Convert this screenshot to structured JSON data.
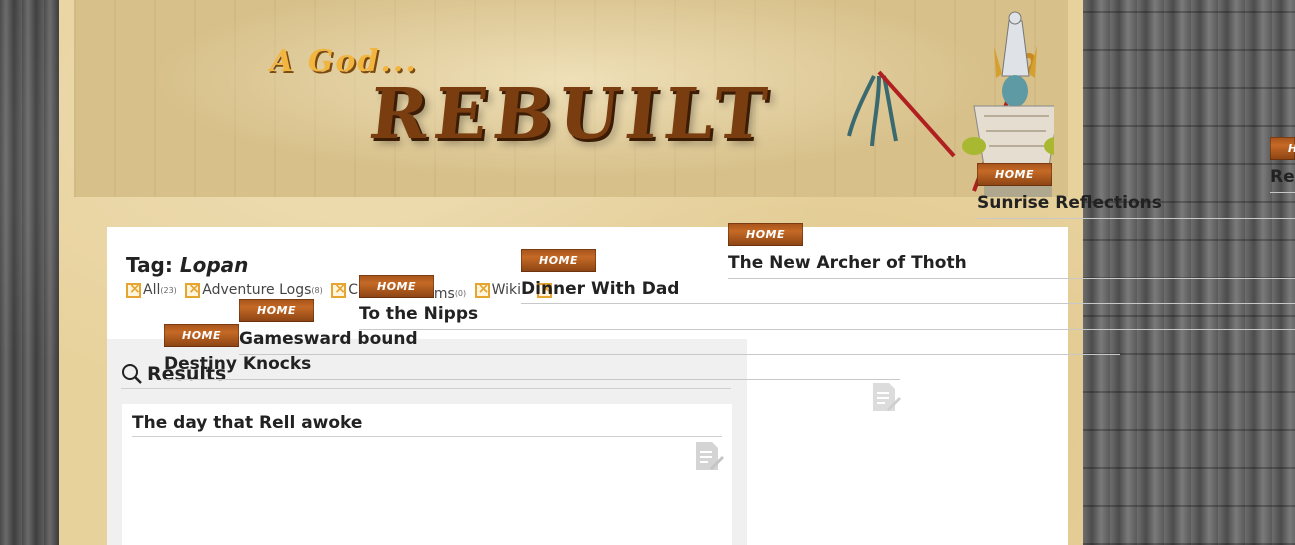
{
  "site": {
    "subtitle": "A God...",
    "title": "REBUILT"
  },
  "tag_page": {
    "prefix": "Tag:",
    "tag": "Lopan"
  },
  "filters": [
    {
      "label": "All",
      "count": "(23)"
    },
    {
      "label": "Adventure Logs",
      "count": "(8)"
    },
    {
      "label": "Char",
      "count": ""
    },
    {
      "label": "Items",
      "count": "(0)"
    },
    {
      "label": "Wiki",
      "count": ""
    },
    {
      "label": "",
      "count": ""
    }
  ],
  "results": {
    "heading": "Results",
    "first_card_title": "The day that Rell awoke"
  },
  "posts": [
    {
      "badge": "HOME",
      "title": "Sunrise Reflections"
    },
    {
      "badge": "HOME",
      "title": "The New Archer of Thoth"
    },
    {
      "badge": "HOME",
      "title": "Dinner With Dad"
    },
    {
      "badge": "HOME",
      "title": "To the Nipps"
    },
    {
      "badge": "HOME",
      "title": "Gamesward bound"
    },
    {
      "badge": "HOME",
      "title": "Destiny Knocks"
    },
    {
      "badge": "H",
      "title": "Re"
    }
  ],
  "colors": {
    "papyrus": "#e8d29c",
    "badge": "#b25c1e",
    "filter_accent": "#e6a431",
    "title_brown": "#7a3d10"
  },
  "icons": [
    "search-icon",
    "note-icon",
    "filter-checkbox-icon"
  ]
}
